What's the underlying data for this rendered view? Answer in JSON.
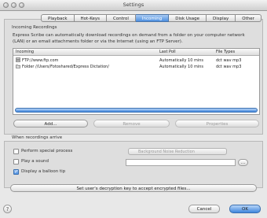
{
  "window": {
    "title": "Settings"
  },
  "tabs": [
    {
      "label": "Playback",
      "active": false
    },
    {
      "label": "Hot-Keys",
      "active": false
    },
    {
      "label": "Control",
      "active": false
    },
    {
      "label": "Incoming",
      "active": true
    },
    {
      "label": "Disk Usage",
      "active": false
    },
    {
      "label": "Display",
      "active": false
    },
    {
      "label": "Other",
      "active": false
    }
  ],
  "incoming": {
    "section_label": "Incoming Recordings",
    "description": "Express Scribe can automatically download recordings on demand from a folder on your computer network (LAN) or an email attachments folder or via the Internet (using an FTP Server).",
    "columns": [
      "Incoming",
      "Last Poll",
      "File Types"
    ],
    "rows": [
      {
        "icon": "ftp-server-icon",
        "incoming": "FTP://www.ftp.com",
        "last_poll": "Automatically 10 mins",
        "types": "dct wav mp3"
      },
      {
        "icon": "folder-icon",
        "incoming": "Folder //Users/Fotoshared/Express Dictation/",
        "last_poll": "Automatically 10 mins",
        "types": "dct wav mp3"
      }
    ],
    "add_label": "Add...",
    "remove_label": "Remove",
    "properties_label": "Properties"
  },
  "arrival": {
    "section_label": "When recordings arrive",
    "perform_label": "Perform special process",
    "perform_checked": false,
    "process_placeholder": "Background Noise Reduction",
    "sound_label": "Play a sound",
    "sound_checked": false,
    "tip_label": "Display a balloon tip",
    "tip_checked": true,
    "decryption_label": "Set user's decryption key to accept encrypted files..."
  },
  "footer": {
    "help_icon_text": "?",
    "cancel_label": "Cancel",
    "ok_label": "OK"
  },
  "checkmark": "✓"
}
